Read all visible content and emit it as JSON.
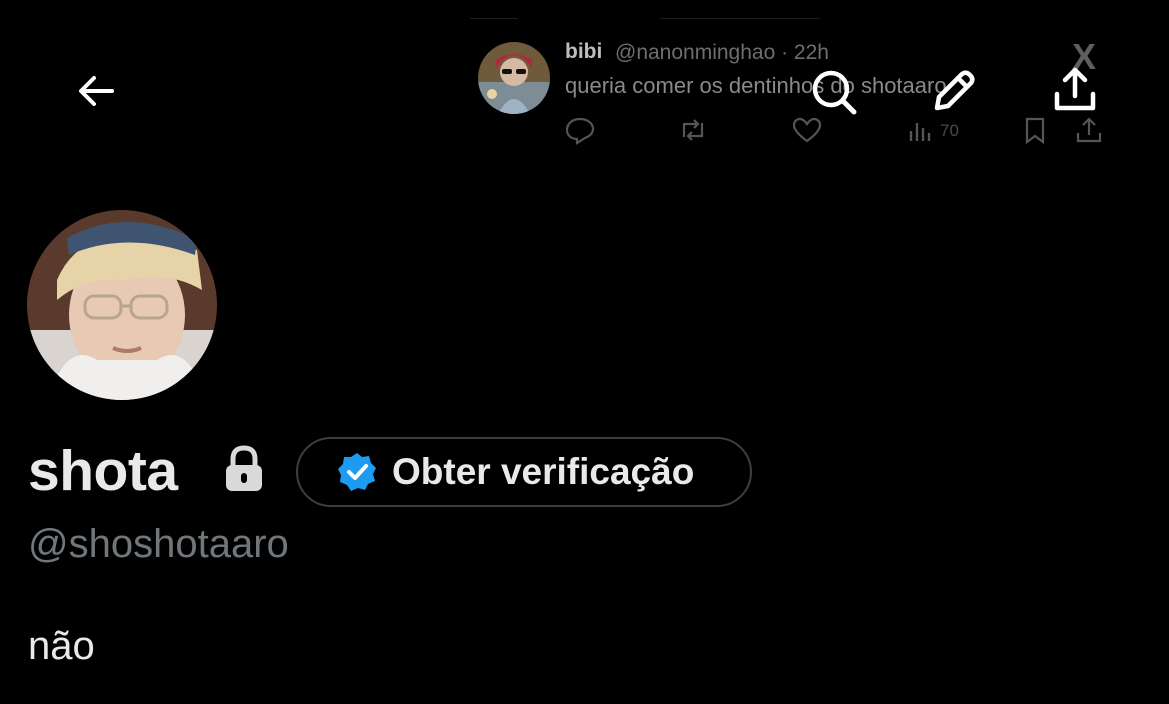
{
  "header": {
    "back_icon": "arrow-left-icon",
    "search_icon": "search-icon",
    "compose_icon": "pencil-icon",
    "share_icon": "share-icon"
  },
  "banner_tweet": {
    "author_name": "bibi",
    "author_handle": "@nanonminghao · 22h",
    "text": "queria comer os dentinhos do shotaaro",
    "views": "70",
    "logo": "X"
  },
  "profile": {
    "display_name": "shota",
    "protected_icon": "lock-icon",
    "verify_button_label": "Obter verificação",
    "handle": "@shoshotaaro",
    "bio": "não"
  },
  "colors": {
    "background": "#000000",
    "text_primary": "#e7e9ea",
    "text_secondary": "#71767b",
    "verified_blue": "#1d9bf0"
  }
}
